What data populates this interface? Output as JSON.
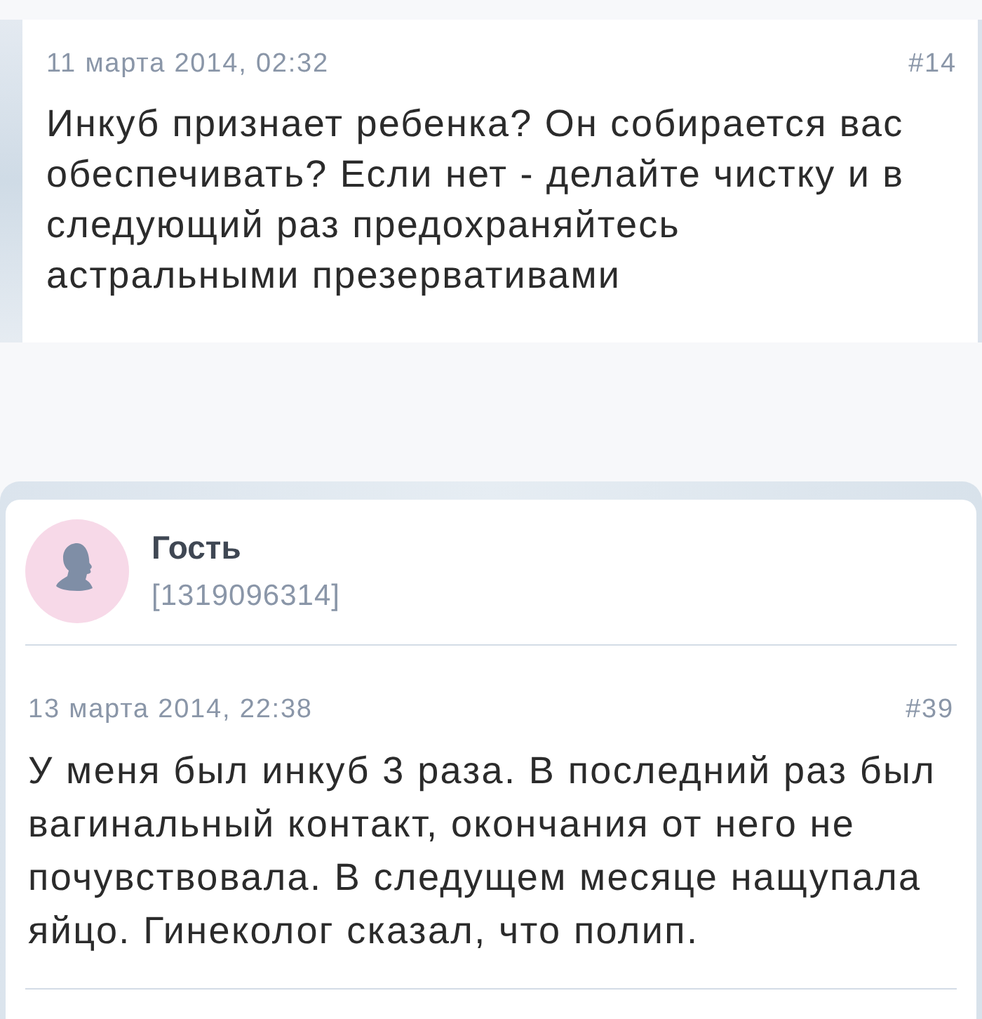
{
  "posts": [
    {
      "date": "11 марта 2014, 02:32",
      "number": "#14",
      "text": "Инкуб признает ребенка? Он собирается вас обеспечивать? Если нет - делайте чистку и в следующий раз предохраняйтесь астральными презервативами"
    },
    {
      "author": {
        "name": "Гость",
        "id": "[1319096314]"
      },
      "date": "13 марта 2014, 22:38",
      "number": "#39",
      "text": "У меня был инкуб 3 раза. В последний раз был вагинальный контакт, окончания от него не почувствовала. В следущем месяце нащупала яйцо. Гинеколог сказал, что полип."
    }
  ]
}
